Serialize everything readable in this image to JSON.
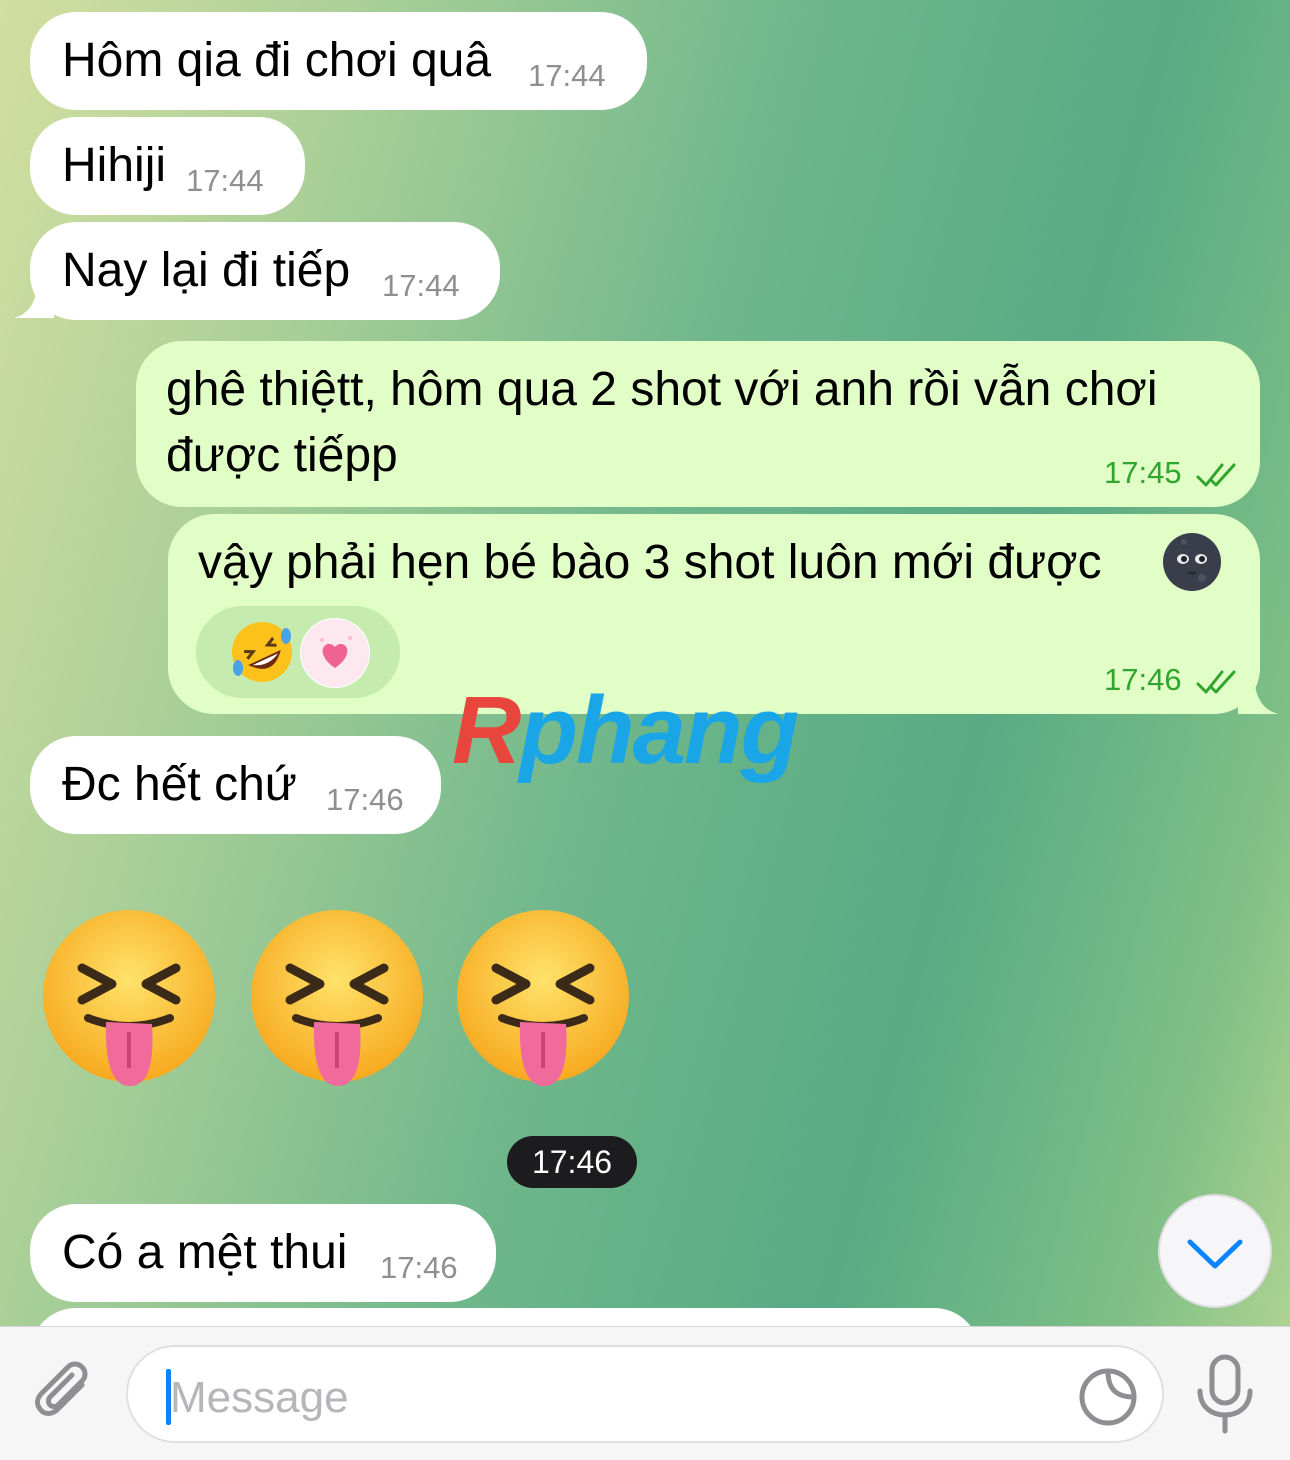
{
  "messages": [
    {
      "dir": "in",
      "text": "Hôm qia đi chơi quâ",
      "time": "17:44"
    },
    {
      "dir": "in",
      "text": "Hihiji",
      "time": "17:44"
    },
    {
      "dir": "in",
      "text": "Nay lại đi tiếp",
      "time": "17:44"
    },
    {
      "dir": "out",
      "line1": "ghê thiệtt, hôm qua 2 shot với anh rồi vẫn chơi",
      "line2": "được tiếpp",
      "time": "17:45",
      "status": "read"
    },
    {
      "dir": "out",
      "text": "vậy phải hẹn bé bào 3 shot luôn mới được",
      "time": "17:46",
      "status": "read",
      "trailing_emoji": "new-moon-face",
      "reactions": [
        "rolling-on-floor-laughing",
        "sparkling-heart"
      ]
    },
    {
      "dir": "in",
      "text": "Đc hết chứ",
      "time": "17:46"
    },
    {
      "dir": "in",
      "emoji_only": [
        "squinting-face-with-tongue",
        "squinting-face-with-tongue",
        "squinting-face-with-tongue"
      ],
      "time": "17:46"
    },
    {
      "dir": "in",
      "text": "Có a mệt thui",
      "time": "17:46"
    }
  ],
  "watermark": {
    "first": "R",
    "rest": "phang"
  },
  "input": {
    "placeholder": "Message"
  },
  "icons": {
    "attach": "paperclip-icon",
    "sticker": "sticker-icon",
    "mic": "microphone-icon",
    "scroll": "chevron-down-icon"
  },
  "colors": {
    "incoming_bubble": "#ffffff",
    "outgoing_bubble": "#e1fec6",
    "outgoing_time": "#2fa52d",
    "accent": "#0a84ff"
  }
}
